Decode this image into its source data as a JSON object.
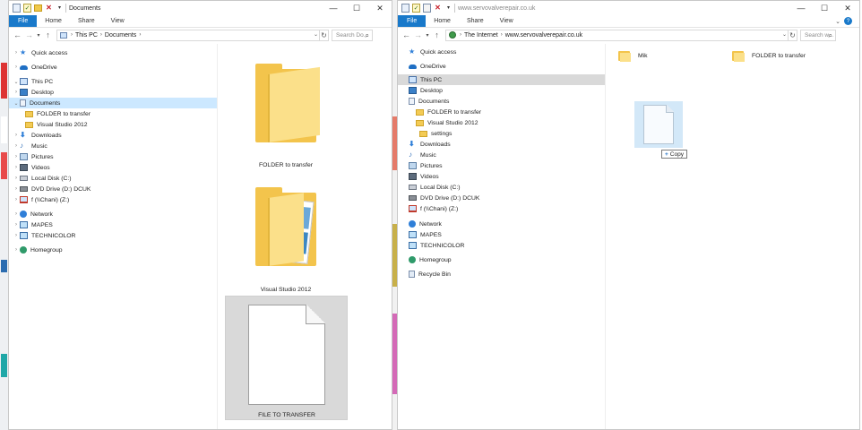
{
  "left_window": {
    "title": "Documents",
    "tabs": [
      "File",
      "Home",
      "Share",
      "View"
    ],
    "address": [
      "This PC",
      "Documents"
    ],
    "search_placeholder": "Search Do...",
    "nav": [
      {
        "label": "Quick access",
        "icon": "star-icon"
      },
      {
        "label": "OneDrive",
        "icon": "cloud-icon"
      },
      {
        "label": "This PC",
        "icon": "computer-icon"
      },
      {
        "label": "Desktop",
        "icon": "desktop-icon"
      },
      {
        "label": "Documents",
        "icon": "documents-icon"
      },
      {
        "label": "FOLDER to transfer",
        "icon": "folder-icon"
      },
      {
        "label": "Visual Studio 2012",
        "icon": "folder-icon"
      },
      {
        "label": "Downloads",
        "icon": "download-icon"
      },
      {
        "label": "Music",
        "icon": "music-icon"
      },
      {
        "label": "Pictures",
        "icon": "pictures-icon"
      },
      {
        "label": "Videos",
        "icon": "videos-icon"
      },
      {
        "label": "Local Disk (C:)",
        "icon": "disk-icon"
      },
      {
        "label": "DVD Drive (D:) DCUK",
        "icon": "dvd-icon"
      },
      {
        "label": "f (\\\\Chani) (Z:)",
        "icon": "network-drive-icon"
      },
      {
        "label": "Network",
        "icon": "network-icon"
      },
      {
        "label": "MAPES",
        "icon": "monitor-icon"
      },
      {
        "label": "TECHNICOLOR",
        "icon": "monitor-icon"
      },
      {
        "label": "Homegroup",
        "icon": "homegroup-icon"
      }
    ],
    "items": [
      "FOLDER to transfer",
      "Visual Studio 2012",
      "FILE TO TRANSFER"
    ]
  },
  "right_window": {
    "title": "www.servovalverepair.co.uk",
    "tabs": [
      "File",
      "Home",
      "Share",
      "View"
    ],
    "address": [
      "The Internet",
      "www.servovalverepair.co.uk"
    ],
    "search_placeholder": "Search w...",
    "nav": [
      {
        "label": "Quick access",
        "icon": "star-icon"
      },
      {
        "label": "OneDrive",
        "icon": "cloud-icon"
      },
      {
        "label": "This PC",
        "icon": "computer-icon"
      },
      {
        "label": "Desktop",
        "icon": "desktop-icon"
      },
      {
        "label": "Documents",
        "icon": "documents-icon"
      },
      {
        "label": "FOLDER to transfer",
        "icon": "folder-icon"
      },
      {
        "label": "Visual Studio 2012",
        "icon": "folder-icon"
      },
      {
        "label": "settings",
        "icon": "folder-icon"
      },
      {
        "label": "Downloads",
        "icon": "download-icon"
      },
      {
        "label": "Music",
        "icon": "music-icon"
      },
      {
        "label": "Pictures",
        "icon": "pictures-icon"
      },
      {
        "label": "Videos",
        "icon": "videos-icon"
      },
      {
        "label": "Local Disk (C:)",
        "icon": "disk-icon"
      },
      {
        "label": "DVD Drive (D:) DCUK",
        "icon": "dvd-icon"
      },
      {
        "label": "f (\\\\Chani) (Z:)",
        "icon": "network-drive-icon"
      },
      {
        "label": "Network",
        "icon": "network-icon"
      },
      {
        "label": "MAPES",
        "icon": "monitor-icon"
      },
      {
        "label": "TECHNICOLOR",
        "icon": "monitor-icon"
      },
      {
        "label": "Homegroup",
        "icon": "homegroup-icon"
      },
      {
        "label": "Recycle Bin",
        "icon": "recycle-bin-icon"
      }
    ],
    "items": [
      "Mik",
      "FOLDER to transfer"
    ],
    "drag_tooltip": "Copy"
  }
}
